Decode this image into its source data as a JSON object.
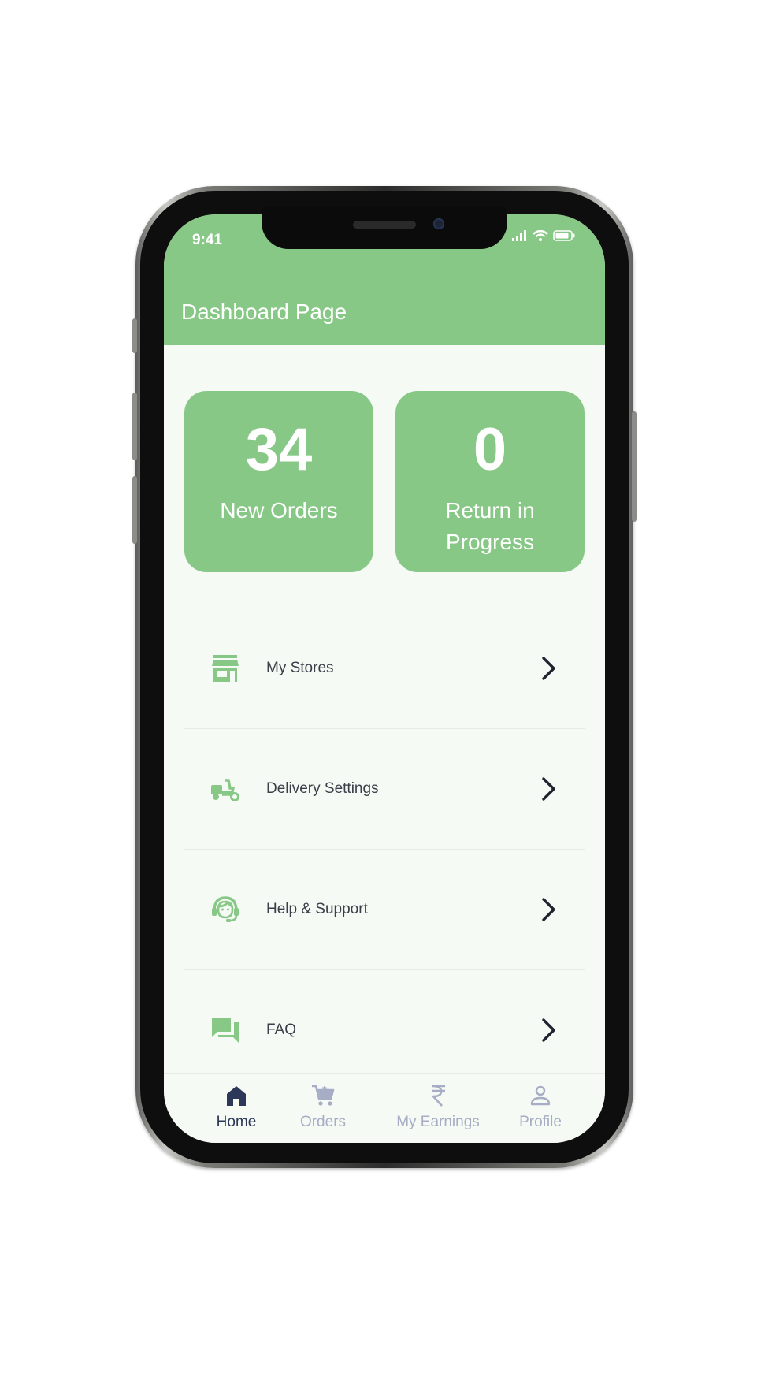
{
  "status_bar": {
    "time": "9:41",
    "icons": [
      "signal-icon",
      "wifi-icon",
      "battery-icon"
    ]
  },
  "header": {
    "title": "Dashboard Page"
  },
  "stats": [
    {
      "value": "34",
      "label": "New Orders"
    },
    {
      "value": "0",
      "label": "Return in Progress"
    }
  ],
  "menu": [
    {
      "label": "My Stores",
      "icon": "store-icon"
    },
    {
      "label": "Delivery Settings",
      "icon": "scooter-icon"
    },
    {
      "label": "Help & Support",
      "icon": "support-agent-icon"
    },
    {
      "label": "FAQ",
      "icon": "forum-icon"
    }
  ],
  "bottom_nav": [
    {
      "label": "Home",
      "icon": "home-icon",
      "active": true
    },
    {
      "label": "Orders",
      "icon": "cart-icon",
      "active": false
    },
    {
      "label": "My Earnings",
      "icon": "rupee-icon",
      "active": false
    },
    {
      "label": "Profile",
      "icon": "person-icon",
      "active": false
    }
  ],
  "colors": {
    "accent": "#88c887",
    "background": "#f5faf4",
    "nav_active": "#2d3757",
    "nav_inactive": "#a6adc4",
    "text": "#3a3f4a"
  }
}
